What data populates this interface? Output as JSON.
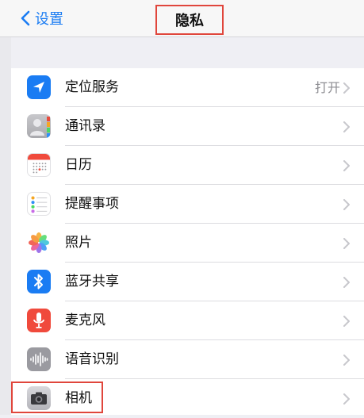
{
  "navbar": {
    "back_label": "设置",
    "title": "隐私"
  },
  "rows": [
    {
      "label": "定位服务",
      "detail": "打开",
      "icon": "location-arrow-icon"
    },
    {
      "label": "通讯录",
      "detail": "",
      "icon": "contacts-icon"
    },
    {
      "label": "日历",
      "detail": "",
      "icon": "calendar-icon"
    },
    {
      "label": "提醒事项",
      "detail": "",
      "icon": "reminders-icon"
    },
    {
      "label": "照片",
      "detail": "",
      "icon": "photos-icon"
    },
    {
      "label": "蓝牙共享",
      "detail": "",
      "icon": "bluetooth-icon"
    },
    {
      "label": "麦克风",
      "detail": "",
      "icon": "microphone-icon"
    },
    {
      "label": "语音识别",
      "detail": "",
      "icon": "speech-recognition-icon"
    },
    {
      "label": "相机",
      "detail": "",
      "icon": "camera-icon"
    }
  ],
  "colors": {
    "accent": "#1a7cf3",
    "highlight_box": "#e0463c"
  }
}
